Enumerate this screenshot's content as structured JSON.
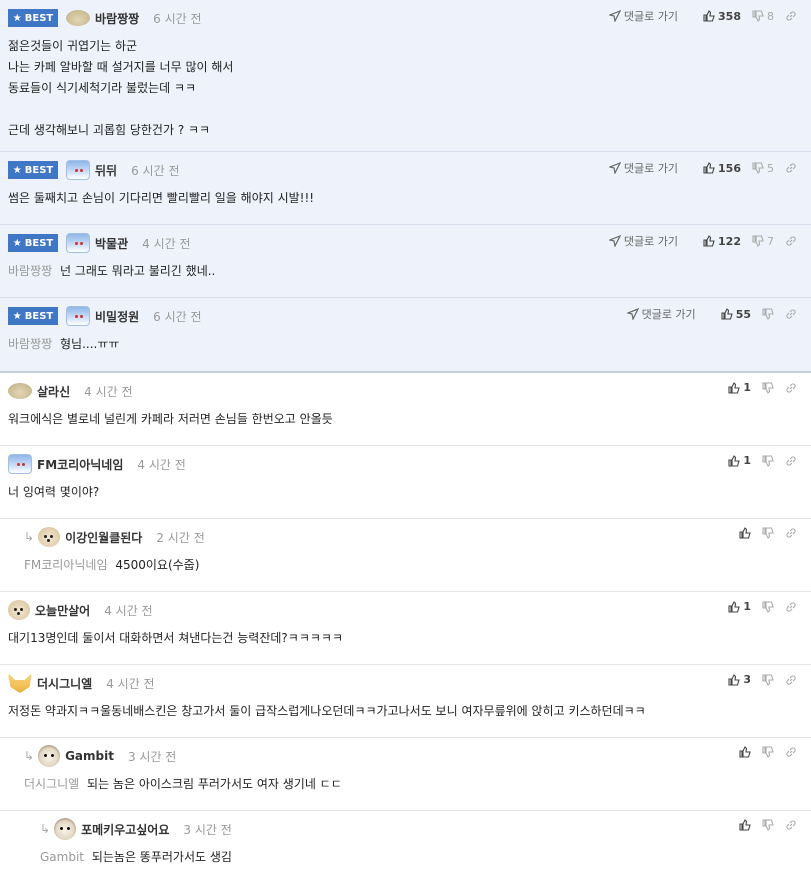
{
  "labels": {
    "best": "BEST",
    "goto": "댓글로 가기"
  },
  "icons": {
    "star": "star-icon",
    "thumbs_up": "thumbs-up-icon",
    "thumbs_down": "thumbs-down-icon",
    "link": "link-icon",
    "arrow": "send-arrow-icon",
    "reply": "reply-arrow-icon"
  },
  "colors": {
    "best_badge": "#3f76c6",
    "best_bg": "#eef3fb"
  },
  "comments": [
    {
      "best": true,
      "avatar": "potato",
      "nick": "바람짱짱",
      "time": "6 시간 전",
      "up": "358",
      "down": "8",
      "lines": [
        "젊은것들이 귀엽기는 하군",
        "나는 카페 알바할 때 설거지를 너무 많이 해서",
        "동료들이 식기세척기라 불렀는데 ㅋㅋ",
        "",
        "근데 생각해보니 괴롭힘 당한건가 ? ㅋㅋ"
      ]
    },
    {
      "best": true,
      "avatar": "ice",
      "nick": "뒤뒤",
      "time": "6 시간 전",
      "up": "156",
      "down": "5",
      "lines": [
        "썸은 둘째치고 손님이 기다리면 빨리빨리 일을 해야지 시발!!!"
      ]
    },
    {
      "best": true,
      "avatar": "ice",
      "nick": "박물관",
      "time": "4 시간 전",
      "up": "122",
      "down": "7",
      "reply_to": "바람짱짱",
      "text": "넌 그래도 뭐라고 불리긴 했네.."
    },
    {
      "best": true,
      "avatar": "ice",
      "nick": "비밀정원",
      "time": "6 시간 전",
      "up": "55",
      "down": "",
      "reply_to": "바람짱짱",
      "text": "형님....ㅠㅠ"
    },
    {
      "avatar": "potato",
      "nick": "살라신",
      "time": "4 시간 전",
      "up": "1",
      "text": "워크에식은 별로네 널린게 카페라 저러면 손님들 한번오고 안올듯"
    },
    {
      "avatar": "ice",
      "nick": "FM코리아닉네임",
      "time": "4 시간 전",
      "up": "1",
      "text": "너 잉여력 몇이야?"
    },
    {
      "avatar": "dog",
      "nick": "이강인월클된다",
      "time": "2 시간 전",
      "up": "",
      "reply_to": "FM코리아닉네임",
      "text": "4500이요(수줍)"
    },
    {
      "avatar": "dog",
      "nick": "오늘만살어",
      "time": "4 시간 전",
      "up": "1",
      "text": "대기13명인데 둘이서 대화하면서 쳐낸다는건 능력잔데?ㅋㅋㅋㅋㅋ"
    },
    {
      "avatar": "fox",
      "nick": "더시그니엘",
      "time": "4 시간 전",
      "up": "3",
      "text": "저정돈 약과지ㅋㅋ울동네배스킨은 창고가서 둘이 급작스럽게나오던데ㅋㅋ가고나서도 보니 여자무릎위에 앉히고 키스하던데ㅋㅋ"
    },
    {
      "avatar": "gambit",
      "nick": "Gambit",
      "time": "3 시간 전",
      "up": "",
      "reply_to": "더시그니엘",
      "text": "되는 놈은 아이스크림 푸러가서도 여자 생기네 ㄷㄷ"
    },
    {
      "avatar": "gambit",
      "nick": "포메키우고싶어요",
      "time": "3 시간 전",
      "up": "",
      "reply_to": "Gambit",
      "text": "되는놈은 똥푸러가서도 생김"
    }
  ]
}
